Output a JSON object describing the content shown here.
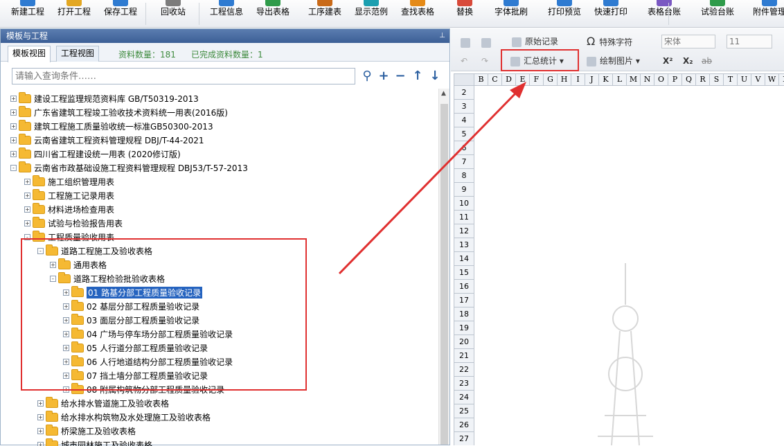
{
  "toolbar": [
    {
      "label": "新建工程",
      "icon": "new-project-icon"
    },
    {
      "label": "打开工程",
      "icon": "open-project-icon"
    },
    {
      "label": "保存工程",
      "icon": "save-project-icon"
    },
    {
      "label": "回收站",
      "icon": "recycle-bin-icon"
    },
    {
      "label": "工程信息",
      "icon": "project-info-icon"
    },
    {
      "label": "导出表格",
      "icon": "export-table-icon"
    },
    {
      "label": "工序建表",
      "icon": "process-table-icon"
    },
    {
      "label": "显示范例",
      "icon": "show-example-icon"
    },
    {
      "label": "查找表格",
      "icon": "find-table-icon"
    },
    {
      "label": "替换",
      "icon": "replace-icon"
    },
    {
      "label": "字体批刷",
      "icon": "font-brush-icon"
    },
    {
      "label": "打印预览",
      "icon": "print-preview-icon"
    },
    {
      "label": "快速打印",
      "icon": "quick-print-icon"
    },
    {
      "label": "表格台账",
      "icon": "table-ledger-icon"
    },
    {
      "label": "试验台账",
      "icon": "test-ledger-icon"
    },
    {
      "label": "附件管理",
      "icon": "attachment-icon"
    }
  ],
  "left_panel": {
    "title": "模板与工程",
    "tabs": [
      "模板视图",
      "工程视图"
    ],
    "count_label": "资料数量：181",
    "done_label": "已完成资料数量：1",
    "search_placeholder": "请输入查询条件……"
  },
  "tree": [
    {
      "text": "建设工程监理规范资料库 GB/T50319-2013",
      "level": 0,
      "exp": "+"
    },
    {
      "text": "广东省建筑工程竣工验收技术资料统一用表(2016版)",
      "level": 0,
      "exp": "+"
    },
    {
      "text": "建筑工程施工质量验收统一标准GB50300-2013",
      "level": 0,
      "exp": "+"
    },
    {
      "text": "云南省建筑工程资料管理规程 DBJ/T-44-2021",
      "level": 0,
      "exp": "+"
    },
    {
      "text": "四川省工程建设统一用表 (2020修订版)",
      "level": 0,
      "exp": "+"
    },
    {
      "text": "云南省市政基础设施工程资料管理规程 DBJ53/T-57-2013",
      "level": 0,
      "exp": "-"
    },
    {
      "text": "施工组织管理用表",
      "level": 1,
      "exp": "+"
    },
    {
      "text": "工程施工记录用表",
      "level": 1,
      "exp": "+"
    },
    {
      "text": "材料进场检查用表",
      "level": 1,
      "exp": "+"
    },
    {
      "text": "试验与检验报告用表",
      "level": 1,
      "exp": "+"
    },
    {
      "text": "工程质量验收用表",
      "level": 1,
      "exp": "-"
    },
    {
      "text": "道路工程施工及验收表格",
      "level": 2,
      "exp": "-"
    },
    {
      "text": "通用表格",
      "level": 3,
      "exp": "+"
    },
    {
      "text": "道路工程检验批验收表格",
      "level": 3,
      "exp": "-"
    },
    {
      "text": "01 路基分部工程质量验收记录",
      "level": 4,
      "exp": "+",
      "selected": true
    },
    {
      "text": "02 基层分部工程质量验收记录",
      "level": 4,
      "exp": "+"
    },
    {
      "text": "03 面层分部工程质量验收记录",
      "level": 4,
      "exp": "+"
    },
    {
      "text": "04 广场与停车场分部工程质量验收记录",
      "level": 4,
      "exp": "+"
    },
    {
      "text": "05 人行道分部工程质量验收记录",
      "level": 4,
      "exp": "+"
    },
    {
      "text": "06 人行地道结构分部工程质量验收记录",
      "level": 4,
      "exp": "+"
    },
    {
      "text": "07 挡土墙分部工程质量验收记录",
      "level": 4,
      "exp": "+"
    },
    {
      "text": "08 附属构筑物分部工程质量验收记录",
      "level": 4,
      "exp": "+"
    },
    {
      "text": "给水排水管道施工及验收表格",
      "level": 2,
      "exp": "+"
    },
    {
      "text": "给水排水构筑物及水处理施工及验收表格",
      "level": 2,
      "exp": "+"
    },
    {
      "text": "桥梁施工及验收表格",
      "level": 2,
      "exp": "+"
    },
    {
      "text": "城市园林施工及验收表格",
      "level": 2,
      "exp": "+"
    }
  ],
  "right_panel": {
    "original_record": "原始记录",
    "special_char": "特殊字符",
    "summary_stats": "汇总统计",
    "draw_picture": "绘制图片",
    "font_name": "宋体",
    "font_size": "11",
    "superscript": "X²",
    "subscript": "X₂",
    "strike": "ab"
  },
  "grid": {
    "columns": [
      "B",
      "C",
      "D",
      "E",
      "F",
      "G",
      "H",
      "I",
      "J",
      "K",
      "L",
      "M",
      "N",
      "O",
      "P",
      "Q",
      "R",
      "S",
      "T",
      "U",
      "V",
      "W",
      "X"
    ],
    "rows": [
      "2",
      "3",
      "4",
      "5",
      "6",
      "7",
      "8",
      "9",
      "10",
      "11",
      "12",
      "13",
      "14",
      "15",
      "16",
      "17",
      "18",
      "19",
      "20",
      "21",
      "22",
      "23",
      "24",
      "25",
      "26",
      "27"
    ]
  },
  "colors": {
    "highlight": "#e03030",
    "selection": "#2563bf",
    "title_bar": "#3c5f96"
  }
}
